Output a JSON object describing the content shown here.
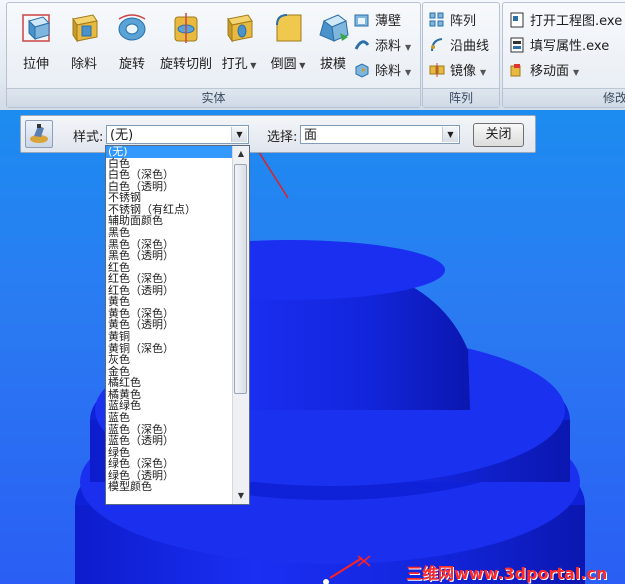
{
  "ribbon": {
    "big_buttons": [
      {
        "label": "拉伸",
        "icon": "extrude-icon"
      },
      {
        "label": "除料",
        "icon": "cut-icon"
      },
      {
        "label": "旋转",
        "icon": "revolve-icon"
      },
      {
        "label": "旋转切削",
        "icon": "revolve-cut-icon"
      },
      {
        "label": "打孔",
        "icon": "hole-icon"
      },
      {
        "label": "倒圆",
        "icon": "fillet-icon"
      },
      {
        "label": "拔模",
        "icon": "draft-icon"
      }
    ],
    "small_buttons": [
      {
        "label": "薄壁",
        "icon": "shell-icon"
      },
      {
        "label": "添料",
        "icon": "add-material-icon"
      },
      {
        "label": "除料",
        "icon": "remove-material-icon"
      }
    ],
    "group_solid": "实体",
    "pattern_buttons": [
      {
        "label": "阵列",
        "icon": "pattern-icon"
      },
      {
        "label": "沿曲线",
        "icon": "curve-pattern-icon"
      },
      {
        "label": "镜像",
        "icon": "mirror-icon"
      }
    ],
    "group_pattern": "阵列",
    "edit_buttons": [
      {
        "label": "打开工程图.exe",
        "icon": "open-drawing-icon"
      },
      {
        "label": "填写属性.exe",
        "icon": "fill-properties-icon"
      },
      {
        "label": "移动面",
        "icon": "move-face-icon"
      }
    ],
    "group_edit": "修改"
  },
  "stylebar": {
    "style_label": "样式:",
    "style_value": "(无)",
    "select_label": "选择:",
    "select_value": "面",
    "close_label": "关闭"
  },
  "dropdown": {
    "items": [
      "(无)",
      "白色",
      "白色（深色）",
      "白色（透明）",
      "不锈钢",
      "不锈钢（有红点）",
      "辅助面颜色",
      "黑色",
      "黑色（深色）",
      "黑色（透明）",
      "红色",
      "红色（深色）",
      "红色（透明）",
      "黄色",
      "黄色（深色）",
      "黄色（透明）",
      "黄铜",
      "黄铜（深色）",
      "灰色",
      "金色",
      "橘红色",
      "橘黄色",
      "蓝绿色",
      "蓝色",
      "蓝色（深色）",
      "蓝色（透明）",
      "绿色",
      "绿色（深色）",
      "绿色（透明）",
      "模型颜色"
    ],
    "selected_index": 0
  },
  "watermark": "三维网www.3dportal.cn"
}
